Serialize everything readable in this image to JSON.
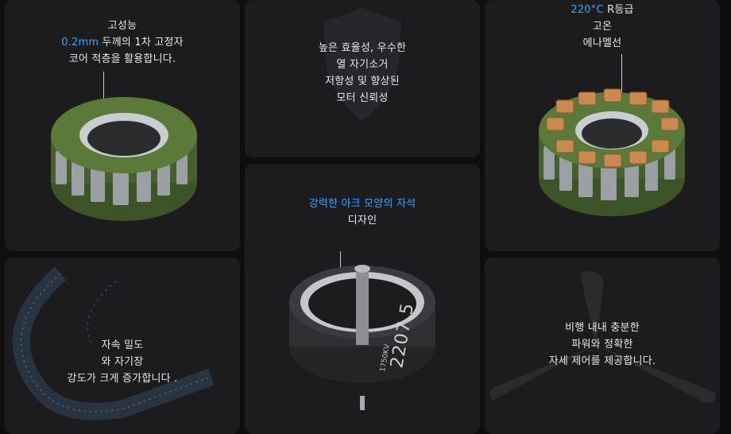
{
  "cards": {
    "stator_core": {
      "line1": "고성능",
      "line2_highlight": "0.2mm",
      "line2_rest": " 두께의 1차 고정자",
      "line3": "코어 적층을 활용합니다."
    },
    "efficiency": {
      "lines": [
        "높은 효율성, 우수한",
        "열 자기소거",
        "저항성 및 향상된",
        "모터 신뢰성"
      ]
    },
    "enamel": {
      "line1_highlight": "220°C",
      "line1_rest": " R등급",
      "line2": "고온",
      "line3": "에나멜선"
    },
    "arc_magnet": {
      "line1_highlight": "강력한 아크 모양의 자석",
      "line2": "디자인"
    },
    "flux": {
      "lines": [
        "자속 밀도",
        "와 자기장",
        "강도가 크게 증가합니다 ."
      ]
    },
    "flight": {
      "lines": [
        "비행 내내 충분한",
        "파워와 정확한",
        "자세 제어를 제공합니다."
      ]
    },
    "motor_label": {
      "model": "2207.5",
      "kv": "1750KV"
    }
  },
  "colors": {
    "highlight": "#35a6ff",
    "card": "#1c1c1e",
    "background": "#0e0e0f",
    "stator_green": "#4f6b34",
    "copper": "#c98a52"
  }
}
